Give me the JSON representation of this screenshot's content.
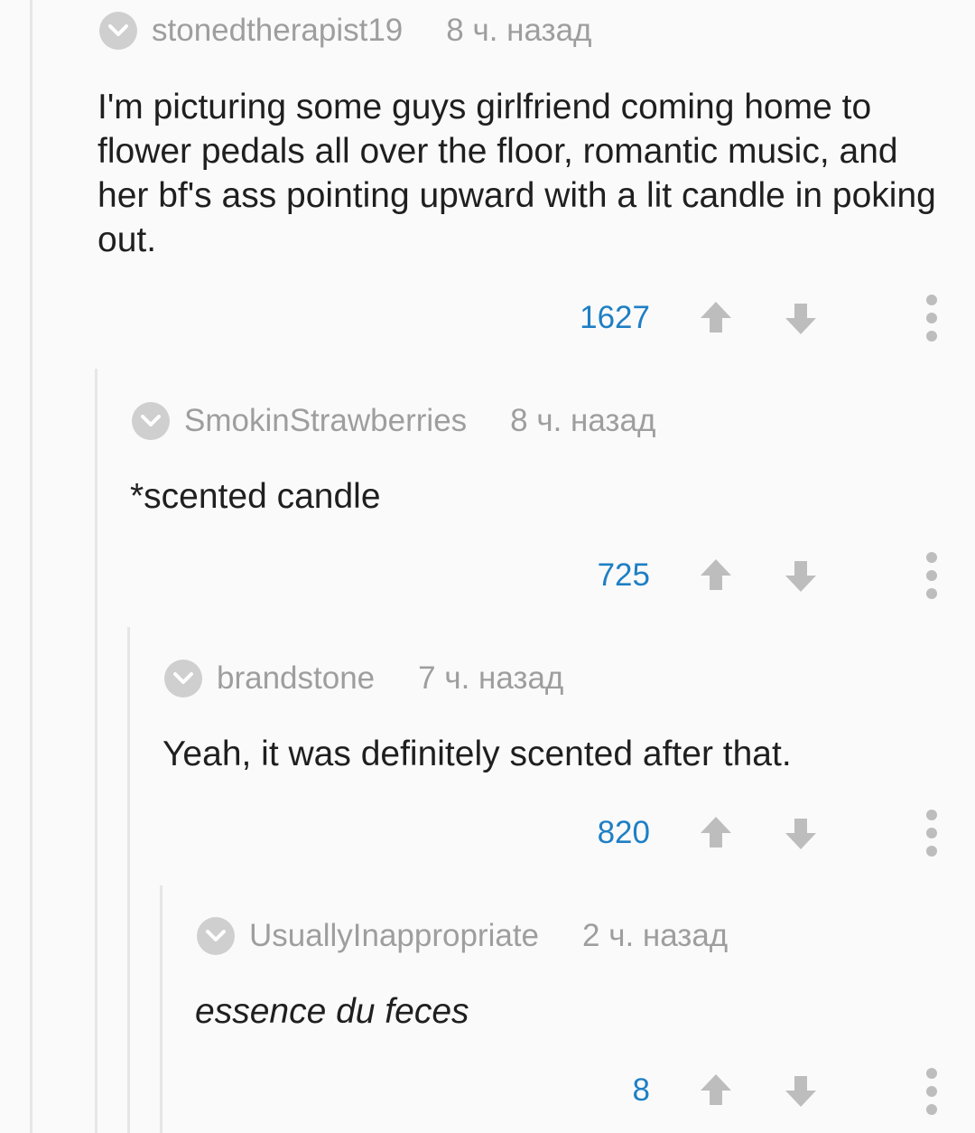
{
  "comments": [
    {
      "username": "stonedtherapist19",
      "time": "8 ч. назад",
      "text": "I'm picturing some guys girlfriend coming home to flower pedals all over the floor, romantic music, and her bf's ass pointing upward with a lit candle in poking out.",
      "score": "1627"
    },
    {
      "username": "SmokinStrawberries",
      "time": "8 ч. назад",
      "text": "*scented candle",
      "score": "725"
    },
    {
      "username": "brandstone",
      "time": "7 ч. назад",
      "text": "Yeah, it was definitely scented after that.",
      "score": "820"
    },
    {
      "username": "UsuallyInappropriate",
      "time": "2 ч. назад",
      "text": "essence du feces",
      "score": "8"
    }
  ],
  "icons": {
    "collapse": "chevron-down-icon",
    "upvote": "arrow-up-icon",
    "downvote": "arrow-down-icon",
    "more": "more-vertical-icon"
  },
  "colors": {
    "background": "#fafafa",
    "username": "#9e9e9e",
    "score": "#1e7fc4",
    "icon": "#bdbdbd",
    "text": "#1f1f1f",
    "thread_line": "#e6e6e6"
  }
}
